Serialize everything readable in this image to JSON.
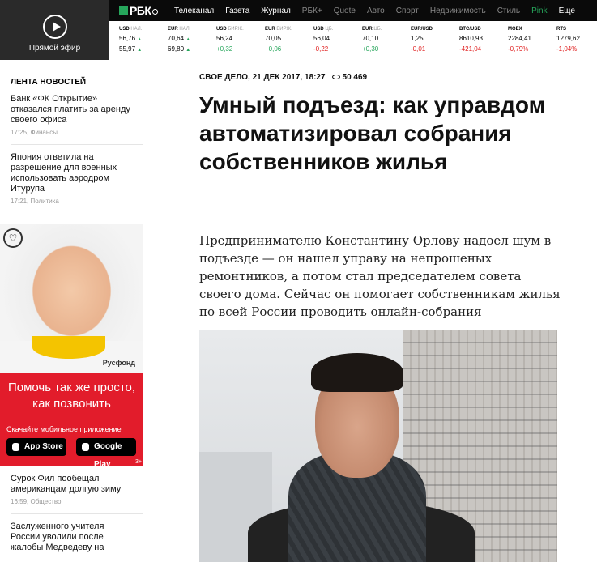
{
  "live": {
    "label": "Прямой эфир"
  },
  "nav": {
    "logo": "РБК",
    "items": [
      {
        "label": "Телеканал",
        "style": "normal"
      },
      {
        "label": "Газета",
        "style": "normal"
      },
      {
        "label": "Журнал",
        "style": "normal"
      },
      {
        "label": "РБК+",
        "style": "dim"
      },
      {
        "label": "Quote",
        "style": "dim"
      },
      {
        "label": "Авто",
        "style": "dim"
      },
      {
        "label": "Спорт",
        "style": "dim"
      },
      {
        "label": "Недвижимость",
        "style": "dim"
      },
      {
        "label": "Стиль",
        "style": "dim"
      },
      {
        "label": "Pink",
        "style": "pink"
      },
      {
        "label": "Еще",
        "style": "normal"
      }
    ]
  },
  "tickers": [
    {
      "name": "USD",
      "sub": "НАЛ.",
      "v1": "56,76",
      "a1": "▲",
      "v2": "55,97",
      "a2": "▲",
      "c1": "up",
      "c2": "up"
    },
    {
      "name": "EUR",
      "sub": "НАЛ.",
      "v1": "70,64",
      "a1": "▲",
      "v2": "69,80",
      "a2": "▲",
      "c1": "up",
      "c2": "up"
    },
    {
      "name": "USD",
      "sub": "БИРЖ.",
      "v1": "56,24",
      "a1": "",
      "v2": "+0,32",
      "a2": "",
      "c1": "",
      "c2": "up"
    },
    {
      "name": "EUR",
      "sub": "БИРЖ.",
      "v1": "70,05",
      "a1": "",
      "v2": "+0,06",
      "a2": "",
      "c1": "",
      "c2": "up"
    },
    {
      "name": "USD",
      "sub": "ЦБ.",
      "v1": "56,04",
      "a1": "",
      "v2": "-0,22",
      "a2": "",
      "c1": "",
      "c2": "dn"
    },
    {
      "name": "EUR",
      "sub": "ЦБ.",
      "v1": "70,10",
      "a1": "",
      "v2": "+0,30",
      "a2": "",
      "c1": "",
      "c2": "up"
    },
    {
      "name": "EUR/USD",
      "sub": "",
      "v1": "1,25",
      "a1": "",
      "v2": "-0,01",
      "a2": "",
      "c1": "",
      "c2": "dn"
    },
    {
      "name": "BTC/USD",
      "sub": "",
      "v1": "8610,93",
      "a1": "",
      "v2": "-421,04",
      "a2": "",
      "c1": "",
      "c2": "dn"
    },
    {
      "name": "MOEX",
      "sub": "",
      "v1": "2284,41",
      "a1": "",
      "v2": "-0,79%",
      "a2": "",
      "c1": "",
      "c2": "dn"
    },
    {
      "name": "RTS",
      "sub": "",
      "v1": "1279,62",
      "a1": "",
      "v2": "-1,04%",
      "a2": "",
      "c1": "",
      "c2": "dn"
    }
  ],
  "sidebar": {
    "heading": "ЛЕНТА НОВОСТЕЙ",
    "news_top": [
      {
        "text": "Банк «ФК Открытие» отказался платить за аренду своего офиса",
        "meta": "17:25, Финансы"
      },
      {
        "text": "Япония ответила на разрешение для военных использовать аэродром Итурупа",
        "meta": "17:21, Политика"
      }
    ],
    "news_bottom": [
      {
        "text": "Сурок Фил пообещал американцам долгую зиму",
        "meta": "16:59, Общество"
      },
      {
        "text": "Заслуженного учителя России уволили после жалобы Медведеву на",
        "meta": ""
      }
    ],
    "ad": {
      "fund": "Русфонд",
      "headline": "Помочь так же просто, как позвонить",
      "download": "Скачайте мобильное приложение",
      "appstore": "App Store",
      "googleplay": "Google Play",
      "age": "3+"
    }
  },
  "article": {
    "rubric_date": "СВОЕ ДЕЛО, 21 ДЕК 2017, 18:27",
    "views": "50 469",
    "title": "Умный подъезд: как управдом автоматизировал собрания собственников жилья",
    "lead": "Предпринимателю Константину Орлову надоел шум в подъезде — он нашел управу на непрошеных ремонтников, а потом стал председателем совета своего дома. Сейчас он помогает собственникам жилья по всей России проводить онлайн-собрания"
  }
}
